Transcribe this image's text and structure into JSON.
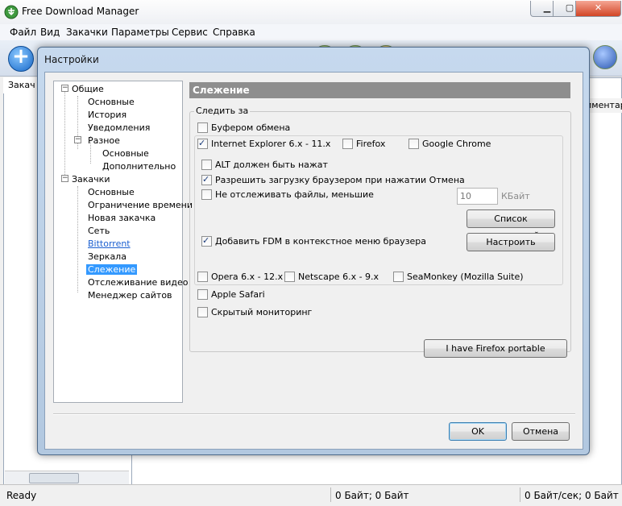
{
  "app": {
    "title": "Free Download Manager",
    "menu": [
      "Файл",
      "Вид",
      "Закачки",
      "Параметры",
      "Сервис",
      "Справка"
    ],
    "left_tab": "Закач",
    "column_header": "мментар",
    "status": {
      "ready": "Ready",
      "size": "0 Байт; 0 Байт",
      "speed": "0 Байт/сек; 0 Байт"
    }
  },
  "dialog": {
    "title": "Настройки",
    "tree": {
      "general": "Общие",
      "general_items": [
        "Основные",
        "История",
        "Уведомления"
      ],
      "misc": "Разное",
      "misc_items": [
        "Основные",
        "Дополнительно"
      ],
      "downloads": "Закачки",
      "download_items": [
        "Основные",
        "Ограничение времени",
        "Новая закачка",
        "Сеть",
        "Bittorrent",
        "Зеркала",
        "Слежение",
        "Отслеживание видео",
        "Менеджер сайтов"
      ]
    },
    "section_title": "Слежение",
    "group_label": "Следить за",
    "options": {
      "clipboard": {
        "label": "Буфером обмена",
        "checked": false
      },
      "ie": {
        "label": "Internet Explorer 6.x - 11.x",
        "checked": true
      },
      "firefox": {
        "label": "Firefox",
        "checked": false
      },
      "chrome": {
        "label": "Google Chrome",
        "checked": false
      },
      "alt": {
        "label": "ALT должен быть нажат",
        "checked": false
      },
      "allow_cancel": {
        "label": "Разрешить загрузку браузером при нажатии Отмена",
        "checked": true
      },
      "skip_small": {
        "label": "Не отслеживать файлы, меньшие",
        "checked": false
      },
      "context_menu": {
        "label": "Добавить FDM в контекстное меню браузера",
        "checked": true
      },
      "opera": {
        "label": "Opera 6.x - 12.x",
        "checked": false
      },
      "netscape": {
        "label": "Netscape 6.x - 9.x",
        "checked": false
      },
      "seamonkey": {
        "label": "SeaMonkey (Mozilla Suite)",
        "checked": false
      },
      "safari": {
        "label": "Apple Safari",
        "checked": false
      },
      "hidden": {
        "label": "Скрытый мониторинг",
        "checked": false
      }
    },
    "min_size": {
      "value": "10",
      "unit": "КБайт"
    },
    "buttons": {
      "exceptions": "Список исключений",
      "configure": "Настроить",
      "firefox_portable": "I have Firefox portable",
      "ok": "OK",
      "cancel": "Отмена"
    },
    "colors": {
      "selection": "#3399ff",
      "section_header": "#8e8e8e",
      "dialog_frame": "#b2c8e0"
    }
  }
}
